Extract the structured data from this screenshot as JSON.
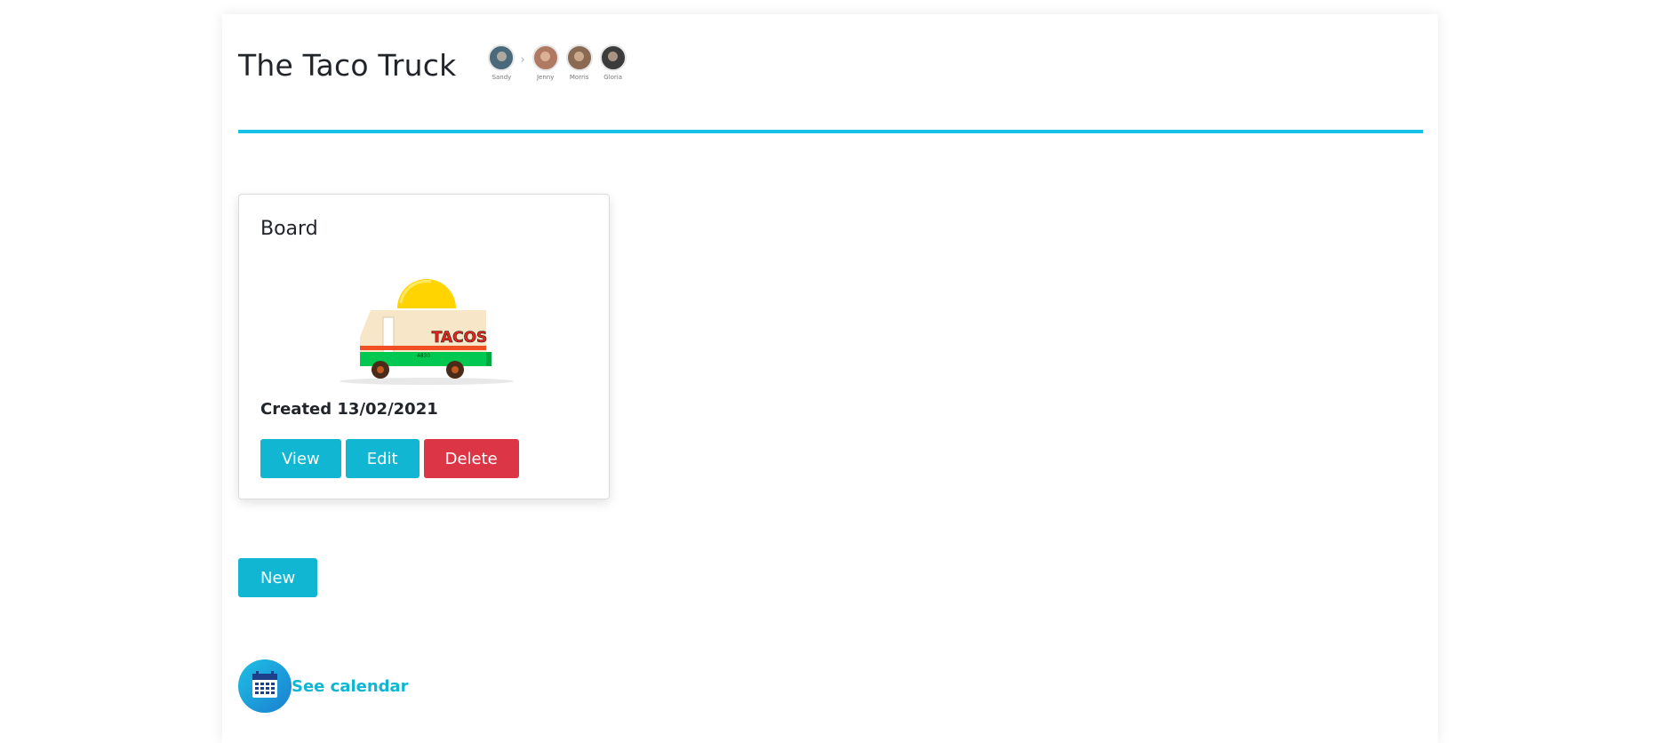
{
  "header": {
    "title": "The Taco Truck",
    "members": [
      {
        "name": "Sandy",
        "color": "#4a6a7c"
      },
      {
        "name": "Jenny",
        "color": "#b07a62"
      },
      {
        "name": "Morris",
        "color": "#8a6a52"
      },
      {
        "name": "Gloria",
        "color": "#3c3c3c"
      }
    ]
  },
  "board_card": {
    "title": "Board",
    "image_text": "TACOS",
    "image_plate": "4830",
    "created_label": "Created 13/02/2021",
    "view_label": "View",
    "edit_label": "Edit",
    "delete_label": "Delete"
  },
  "actions": {
    "new_label": "New",
    "calendar_label": "See calendar"
  },
  "colors": {
    "accent": "#17c1e8",
    "info_button": "#11b6d2",
    "danger_button": "#dc3545"
  }
}
